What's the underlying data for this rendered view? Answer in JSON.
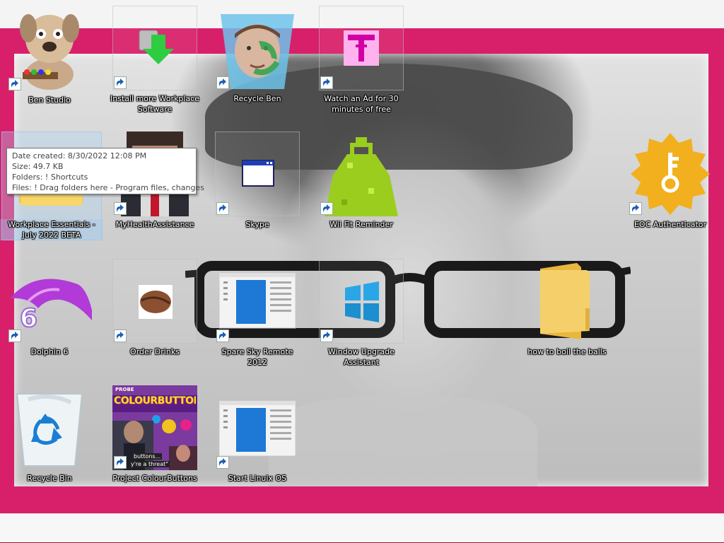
{
  "desktop": {
    "icons": [
      {
        "label": "Ben Studio",
        "icon": "ben-dog-icon",
        "shortcut": true
      },
      {
        "label": "Install more Workplace Software",
        "icon": "download-arrow-icon",
        "shortcut": true
      },
      {
        "label": "Recycle Ben",
        "icon": "recycle-ben-icon",
        "shortcut": true
      },
      {
        "label": "Watch an Ad for 30 minutes of free",
        "icon": "pink-t-icon",
        "shortcut": true
      },
      {
        "label": "Workplace Essentials - July 2022 BETA",
        "icon": "folder-icon",
        "shortcut": false
      },
      {
        "label": "MyHealthAssistance",
        "icon": "pixel-man-icon",
        "shortcut": true
      },
      {
        "label": "Skype",
        "icon": "window-icon",
        "shortcut": true
      },
      {
        "label": "Wii Fit Reminder",
        "icon": "green-kettlebell-icon",
        "shortcut": true
      },
      {
        "label": "EOC Authenticator",
        "icon": "key-badge-icon",
        "shortcut": true
      },
      {
        "label": "Dolphin 6",
        "icon": "dolphin-icon",
        "shortcut": true
      },
      {
        "label": "Order Drinks",
        "icon": "coffee-bean-icon",
        "shortcut": true
      },
      {
        "label": "Spare Sky Remote 2012",
        "icon": "app-window-icon",
        "shortcut": true
      },
      {
        "label": "Window Upgrade Assistant",
        "icon": "windows-logo-icon",
        "shortcut": true
      },
      {
        "label": "how to boil the balls",
        "icon": "folder-icon",
        "shortcut": false
      },
      {
        "label": "Recycle Bin",
        "icon": "recycle-bin-icon",
        "shortcut": false
      },
      {
        "label": "Project ColourButtons",
        "icon": "colourbuttons-poster-icon",
        "shortcut": true
      },
      {
        "label": "Start Linuix OS",
        "icon": "app-window-icon",
        "shortcut": true
      }
    ],
    "poster_text": {
      "brand": "PROBE",
      "title": "COLOURBUTTONS",
      "caption_1": "buttons...",
      "caption_2": "y're a threat\""
    }
  },
  "tooltip": {
    "date_created": "Date created: 8/30/2022 12:08 PM",
    "size": "Size: 49.7 KB",
    "folders": "Folders: ! Shortcuts",
    "files": "Files: ! Drag folders here - Program files, changes"
  },
  "colors": {
    "frame": "#d8206a",
    "taskbar_accent": "#a0142e",
    "label_text": "#ffffff"
  }
}
